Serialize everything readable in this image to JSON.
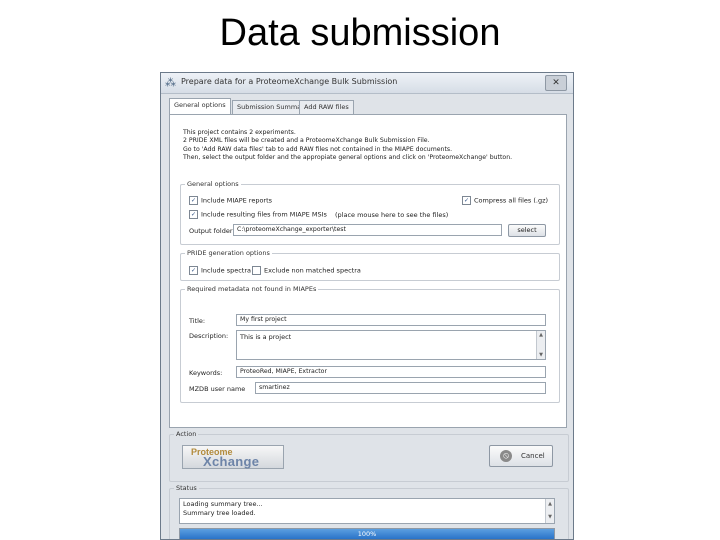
{
  "slide": {
    "title": "Data submission"
  },
  "window": {
    "title": "Prepare data for a ProteomeXchange Bulk Submission",
    "close_label": "✕"
  },
  "tabs": [
    {
      "label": "General options",
      "active": true
    },
    {
      "label": "Submission Summary"
    },
    {
      "label": "Add RAW files"
    }
  ],
  "info": [
    "This project contains 2 experiments.",
    "2 PRIDE XML files will be created and a ProteomeXchange Bulk Submission File.",
    "Go to 'Add RAW data files' tab to add RAW files not contained in the MIAPE documents.",
    "Then, select the output folder and the appropiate general options and click on 'ProteomeXchange' button."
  ],
  "general_options": {
    "legend": "General options",
    "include_miape_reports": {
      "label": "Include MIAPE reports",
      "checked": true
    },
    "include_resulting_files": {
      "label": "Include resulting files from MIAPE MSIs",
      "checked": true
    },
    "hint": "(place mouse here to see the files)",
    "compress_all": {
      "label": "Compress all files (.gz)",
      "checked": true
    },
    "output_folder_label": "Output folder",
    "output_folder_value": "C:\\proteomeXchange_exporter\\test",
    "select_button": "select"
  },
  "pride_options": {
    "legend": "PRIDE generation options",
    "include_spectra": {
      "label": "Include spectra",
      "checked": true
    },
    "exclude_non_matched": {
      "label": "Exclude non matched spectra",
      "checked": false
    }
  },
  "metadata": {
    "legend": "Required metadata not found in MIAPEs",
    "title_label": "Title:",
    "title_value": "My first project",
    "description_label": "Description:",
    "description_value": "This is a project",
    "keywords_label": "Keywords:",
    "keywords_value": "ProteoRed, MIAPE, Extractor",
    "mzdb_label": "MZDB user name",
    "mzdb_value": "smartinez"
  },
  "action": {
    "legend": "Action",
    "proteomexchange_logo_top": "Proteome",
    "proteomexchange_logo_bottom": "Xchange",
    "cancel_label": "Cancel",
    "cancel_icon": "cancel-circle-icon"
  },
  "status": {
    "legend": "Status",
    "lines": [
      "Loading summary tree...",
      "Summary tree loaded."
    ],
    "progress_percent": 100,
    "progress_label": "100%"
  }
}
